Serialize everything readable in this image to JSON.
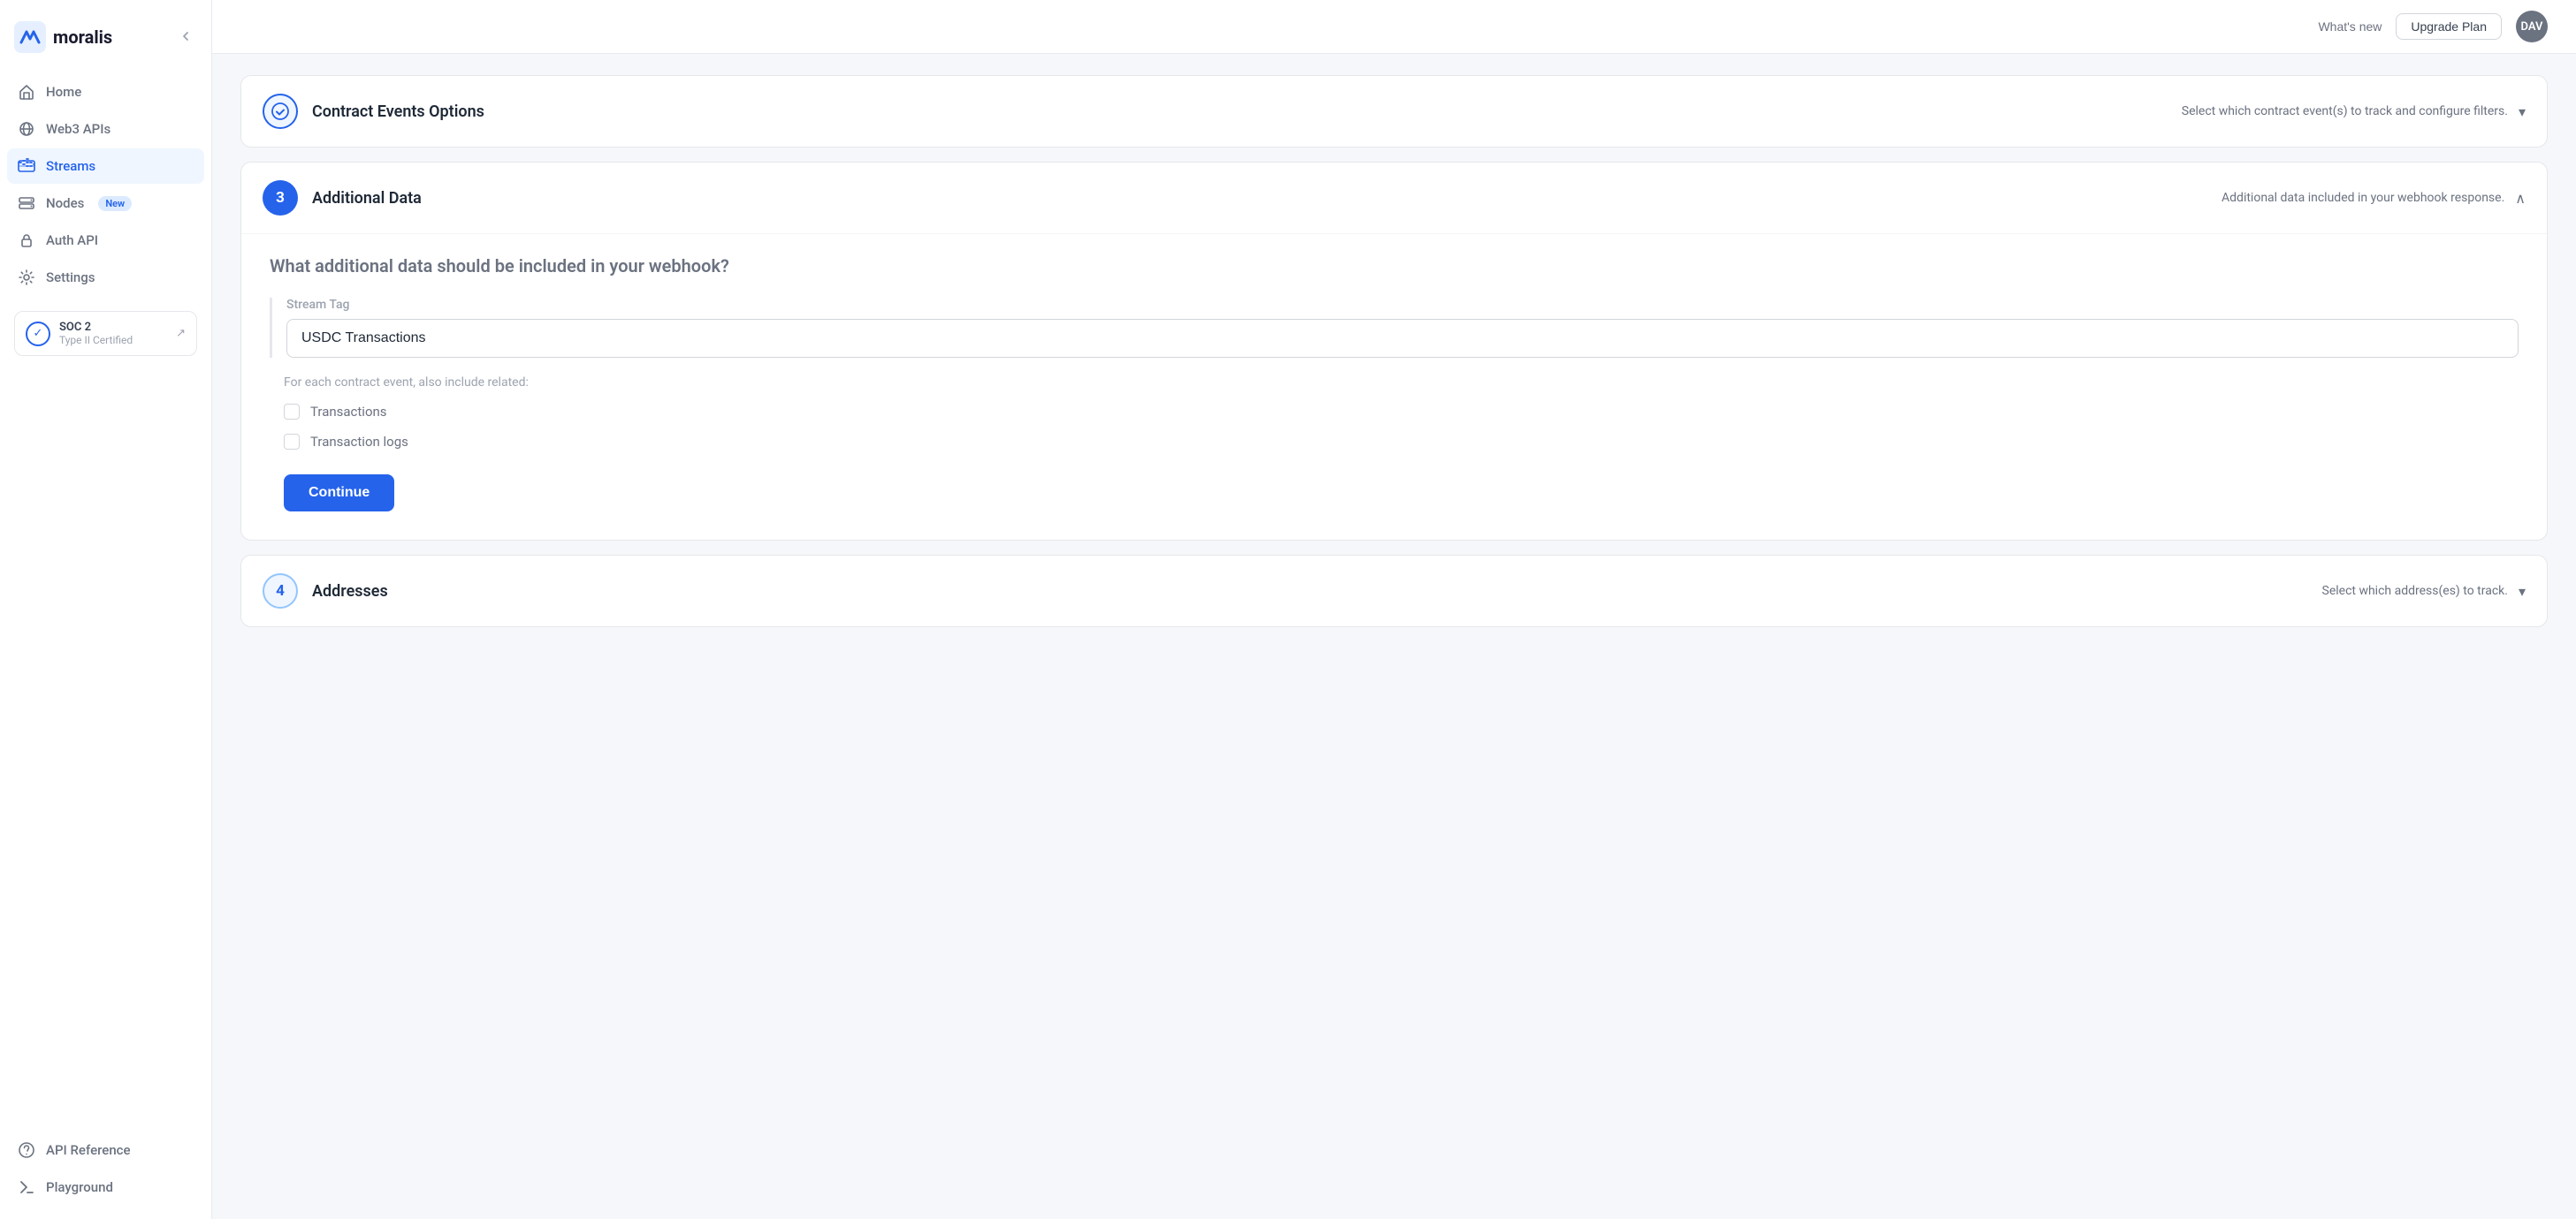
{
  "brand": {
    "name": "moralis"
  },
  "header": {
    "whats_new": "What's new",
    "upgrade_label": "Upgrade Plan",
    "avatar_initials": "DAV"
  },
  "sidebar": {
    "items": [
      {
        "id": "home",
        "label": "Home",
        "icon": "home-icon",
        "active": false
      },
      {
        "id": "web3apis",
        "label": "Web3 APIs",
        "icon": "web3apis-icon",
        "active": false
      },
      {
        "id": "streams",
        "label": "Streams",
        "icon": "streams-icon",
        "active": true
      },
      {
        "id": "nodes",
        "label": "Nodes",
        "icon": "nodes-icon",
        "active": false,
        "badge": "New"
      },
      {
        "id": "authapi",
        "label": "Auth API",
        "icon": "authapi-icon",
        "active": false
      },
      {
        "id": "settings",
        "label": "Settings",
        "icon": "settings-icon",
        "active": false
      }
    ],
    "soc": {
      "title": "SOC 2",
      "subtitle": "Type II Certified"
    },
    "bottom_items": [
      {
        "id": "apireference",
        "label": "API Reference",
        "icon": "apireference-icon"
      },
      {
        "id": "playground",
        "label": "Playground",
        "icon": "playground-icon"
      }
    ]
  },
  "contract_events_card": {
    "step_number": "✓",
    "step_type": "completed",
    "title": "Contract Events Options",
    "description": "Select which contract event(s) to track and configure filters.",
    "chevron": "▾",
    "collapsed": true
  },
  "additional_data_card": {
    "step_number": "3",
    "step_type": "active",
    "title": "Additional Data",
    "description": "Additional data included in your webhook response.",
    "chevron": "∧",
    "collapsed": false,
    "question": "What additional data should be included in your webhook?",
    "stream_tag": {
      "label": "Stream Tag",
      "placeholder": "",
      "value": "USDC Transactions"
    },
    "related_label": "For each contract event, also include related:",
    "checkboxes": [
      {
        "id": "transactions",
        "label": "Transactions",
        "checked": false
      },
      {
        "id": "transaction_logs",
        "label": "Transaction logs",
        "checked": false
      }
    ],
    "continue_button": "Continue"
  },
  "addresses_card": {
    "step_number": "4",
    "step_type": "inactive",
    "title": "Addresses",
    "description": "Select which address(es) to track.",
    "chevron": "▾",
    "collapsed": true
  }
}
